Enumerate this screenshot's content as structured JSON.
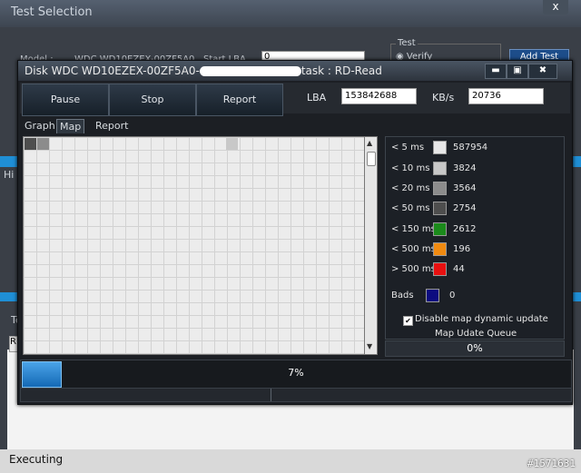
{
  "background": {
    "title": "Test Selection",
    "close_label": "x",
    "model_label": "Model :",
    "model_value": "WDC WD10EZEX-00ZF5A0",
    "start_lba_label": "Start LBA",
    "start_lba_value": "0",
    "test_group_label": "Test",
    "verify_label": "Verify",
    "add_test_label": "Add Test",
    "bg_tab_r": "R",
    "bg_hi": "Hi",
    "bg_te": "Te"
  },
  "status": {
    "text": "Executing"
  },
  "watermark": "#1571631",
  "dialog": {
    "title_prefix": "Disk WDC WD10EZEX-00ZF5A0-",
    "title_suffix": "task : RD-Read",
    "window_buttons": {
      "minimize": "▬",
      "maximize": "▣",
      "close": "✖"
    },
    "toolbar": {
      "pause_label": "Pause",
      "stop_label": "Stop",
      "report_label": "Report",
      "lba_label": "LBA",
      "lba_value": "153842688",
      "kbs_label": "KB/s",
      "kbs_value": "20736"
    },
    "tabs": [
      {
        "label": "Graph",
        "active": false
      },
      {
        "label": "Map",
        "active": true
      },
      {
        "label": "Report",
        "active": false
      }
    ],
    "legend": [
      {
        "label": "< 5 ms",
        "color": "#e8e8e8",
        "count": "587954"
      },
      {
        "label": "< 10 ms",
        "color": "#c8c8c8",
        "count": "3824"
      },
      {
        "label": "< 20 ms",
        "color": "#8c8c8c",
        "count": "3564"
      },
      {
        "label": "< 50 ms",
        "color": "#4e4e4e",
        "count": "2754"
      },
      {
        "label": "< 150 ms",
        "color": "#1b8a1b",
        "count": "2612"
      },
      {
        "label": "< 500 ms",
        "color": "#f08a10",
        "count": "196"
      },
      {
        "label": "> 500 ms",
        "color": "#e81010",
        "count": "44"
      },
      {
        "label": "Bads",
        "color": "#0c0c80",
        "count": "0"
      }
    ],
    "dynamic_update_label": "Disable map dynamic update",
    "dynamic_update_checked": true,
    "map_queue_label": "Map Udate Queue",
    "map_queue_value": "0%",
    "progress_text": "7%",
    "progress_value": 0.07
  }
}
